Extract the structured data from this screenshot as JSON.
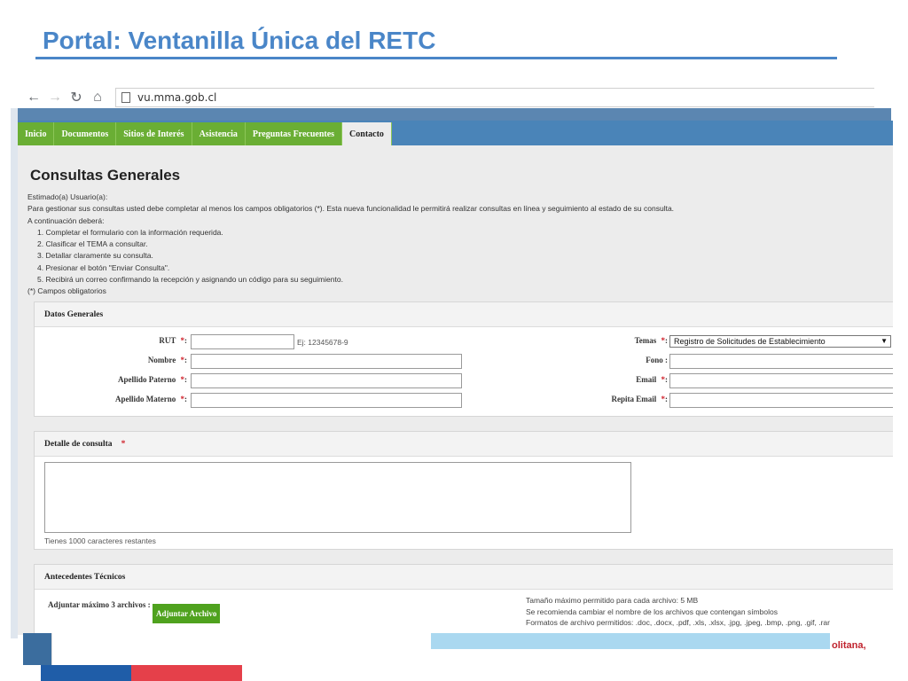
{
  "slide": {
    "title": "Portal: Ventanilla Única del RETC",
    "corner_text": "olitana,"
  },
  "browser": {
    "url": "vu.mma.gob.cl"
  },
  "menu": {
    "items": [
      "Inicio",
      "Documentos",
      "Sitios de Interés",
      "Asistencia",
      "Preguntas Frecuentes",
      "Contacto"
    ],
    "active": "Contacto"
  },
  "page": {
    "heading": "Consultas Generales",
    "intro": {
      "greeting": "Estimado(a) Usuario(a):",
      "line1": "Para gestionar sus consultas usted debe completar al menos los campos obligatorios (*). Esta nueva funcionalidad le permitirá realizar consultas en línea y seguimiento al estado de su consulta.",
      "line2": "A continuación deberá:",
      "steps": [
        "1. Completar el formulario con la información requerida.",
        "2. Clasificar el TEMA a consultar.",
        "3. Detallar claramente su consulta.",
        "4. Presionar el botón \"Enviar Consulta\".",
        "5. Recibirá un correo confirmando la recepción y asignando un código para su seguimiento."
      ],
      "footnote": "(*) Campos obligatorios"
    }
  },
  "datos_generales": {
    "title": "Datos Generales",
    "rut_label": "RUT",
    "rut_value": "",
    "rut_hint": "Ej: 12345678-9",
    "nombre_label": "Nombre",
    "apellido_paterno_label": "Apellido Paterno",
    "apellido_materno_label": "Apellido Materno",
    "temas_label": "Temas",
    "temas_value": "Registro de Solicitudes de Establecimiento",
    "fono_label": "Fono",
    "email_label": "Email",
    "repita_email_label": "Repita Email",
    "required_mark": "*",
    "colon": ":"
  },
  "detalle": {
    "title": "Detalle de consulta",
    "required_mark": "*",
    "counter": "Tienes 1000 caracteres restantes"
  },
  "antecedentes": {
    "title": "Antecedentes Técnicos",
    "adjuntar_label": "Adjuntar máximo 3 archivos :",
    "button": "Adjuntar Archivo",
    "info": [
      "Tamaño máximo permitido para cada archivo: 5 MB",
      "Se recomienda cambiar el nombre de los archivos que contengan símbolos",
      "Formatos de archivo permitidos: .doc, .docx, .pdf, .xls, .xlsx, .jpg, .jpeg, .bmp, .png, .gif, .rar"
    ]
  },
  "colors": {
    "menu_green": "#6aae34",
    "menu_blue": "#4a84b8",
    "title_blue": "#4a86c8",
    "required_red": "#d0202a"
  }
}
